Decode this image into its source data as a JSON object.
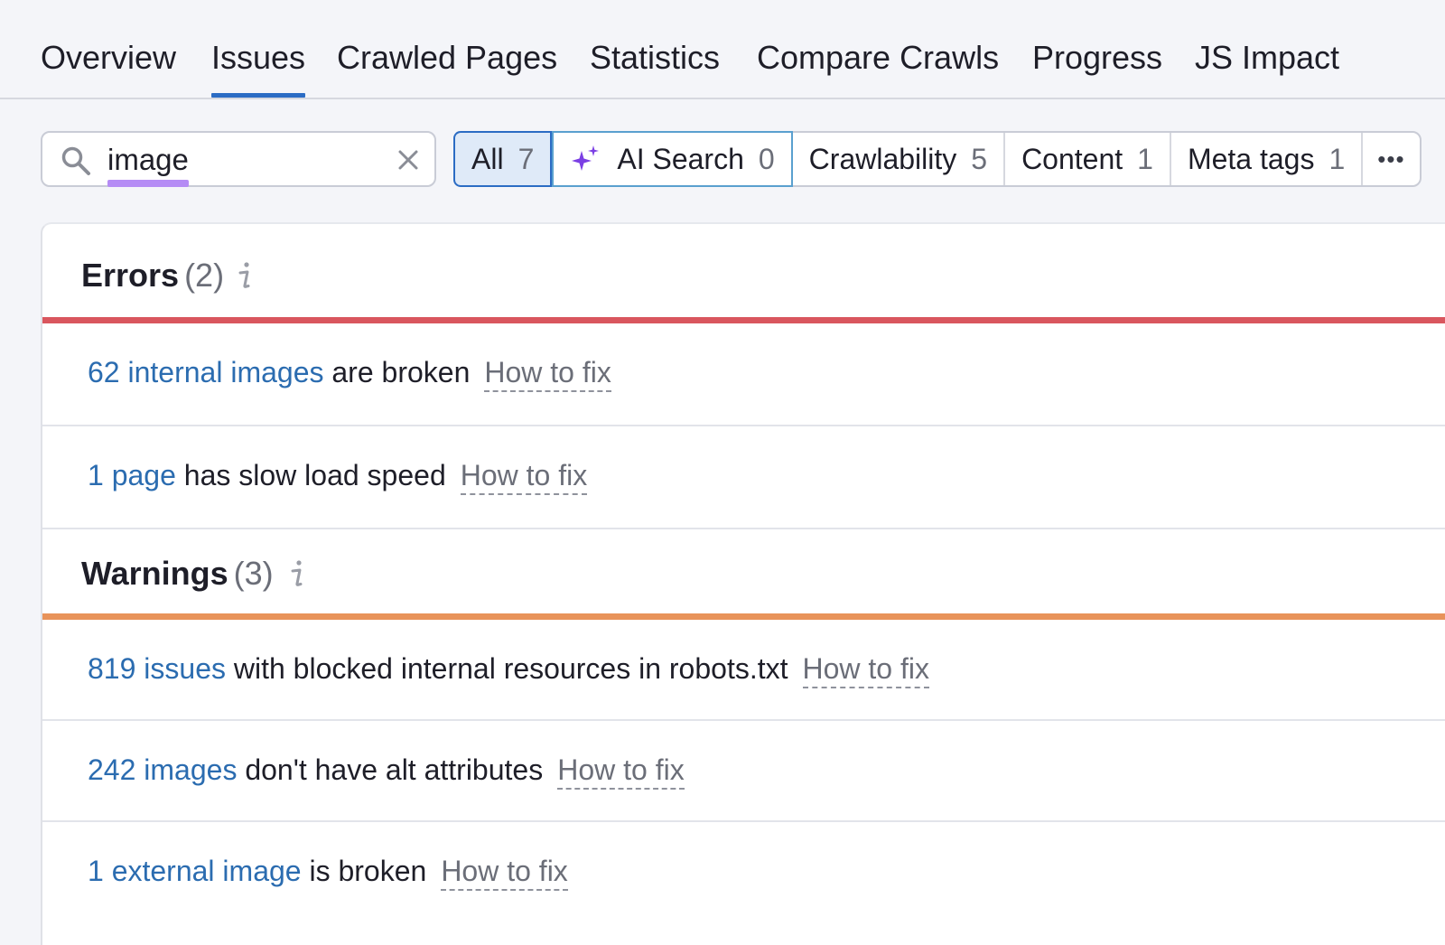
{
  "tabs": [
    "Overview",
    "Issues",
    "Crawled Pages",
    "Statistics",
    "Compare Crawls",
    "Progress",
    "JS Impact"
  ],
  "active_tab": "Issues",
  "search": {
    "value": "image"
  },
  "filters": {
    "all": {
      "label": "All",
      "count": "7"
    },
    "ai_search": {
      "label": "AI Search",
      "count": "0"
    },
    "crawlability": {
      "label": "Crawlability",
      "count": "5"
    },
    "content": {
      "label": "Content",
      "count": "1"
    },
    "meta_tags": {
      "label": "Meta tags",
      "count": "1"
    },
    "more": "•••"
  },
  "errors": {
    "title": "Errors",
    "count": "(2)",
    "color": "#d9565e",
    "items": [
      {
        "link": "62 internal images",
        "text": " are broken",
        "fix": "How to fix"
      },
      {
        "link": "1 page",
        "text": " has slow load speed",
        "fix": "How to fix"
      }
    ]
  },
  "warnings": {
    "title": "Warnings",
    "count": "(3)",
    "color": "#e8935a",
    "items": [
      {
        "link": "819 issues",
        "text": " with blocked internal resources in robots.txt",
        "fix": "How to fix"
      },
      {
        "link": "242 images",
        "text": " don't have alt attributes",
        "fix": "How to fix"
      },
      {
        "link": "1 external image",
        "text": " is broken",
        "fix": "How to fix"
      }
    ]
  },
  "icons": {
    "search": "search-icon",
    "clear": "close-icon",
    "ai": "sparkle-icon",
    "info": "info-icon"
  },
  "accent": "#2b6cc4"
}
